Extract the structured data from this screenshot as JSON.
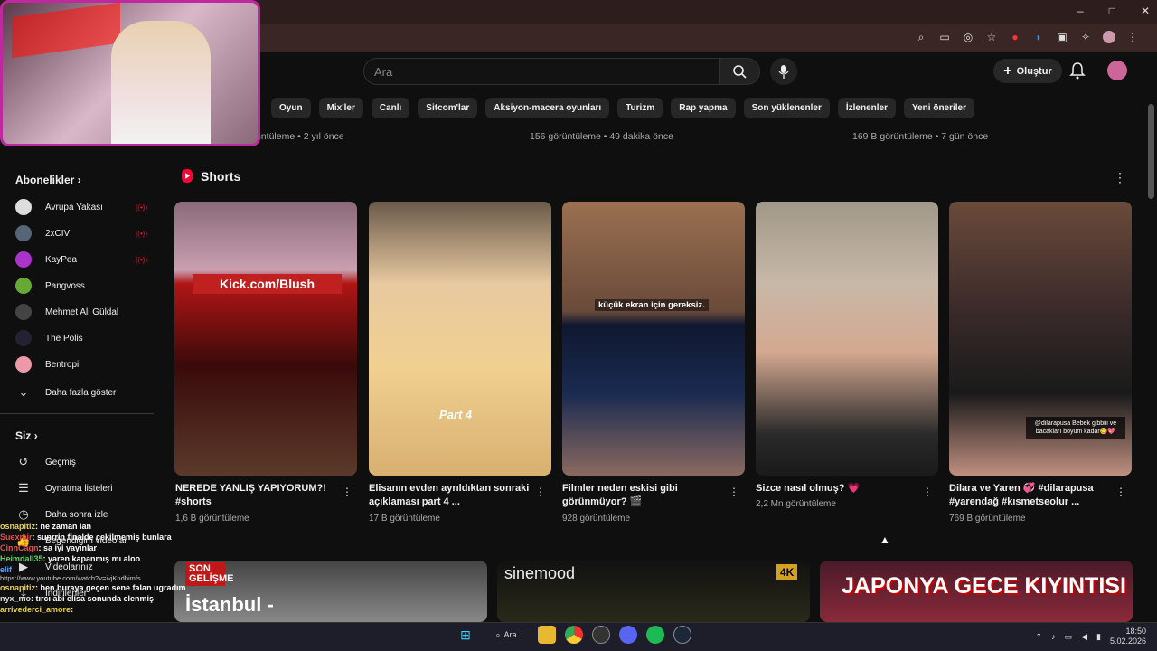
{
  "window": {
    "min": "–",
    "max": "□",
    "close": "✕"
  },
  "search": {
    "placeholder": "Ara"
  },
  "header": {
    "create_label": "Oluştur"
  },
  "chips": [
    "Oyun",
    "Mix'ler",
    "Canlı",
    "Sitcom'lar",
    "Aksiyon-macera oyunları",
    "Turizm",
    "Rap yapma",
    "Son yüklenenler",
    "İzlenenler",
    "Yeni öneriler"
  ],
  "prev_row": {
    "v1": "üntüleme • 2 yıl önce",
    "v2": "156 görüntüleme • 49 dakika önce",
    "v3": "169 B görüntüleme • 7 gün önce"
  },
  "sidebar": {
    "subscriptions_title": "Abonelikler",
    "subs": [
      {
        "label": "Avrupa Yakası",
        "color": "#ddd",
        "live": true
      },
      {
        "label": "2xCIV",
        "color": "#567",
        "live": true
      },
      {
        "label": "KayPea",
        "color": "#a3c",
        "live": true
      },
      {
        "label": "Pangvoss",
        "color": "#6a3",
        "live": false
      },
      {
        "label": "Mehmet Ali Güldal",
        "color": "#444",
        "live": false
      },
      {
        "label": "The Polis",
        "color": "#223",
        "live": false
      },
      {
        "label": "Bentropi",
        "color": "#e9a",
        "live": false
      }
    ],
    "show_more": "Daha fazla göster",
    "you_title": "Siz",
    "you_items": [
      "Geçmiş",
      "Oynatma listeleri",
      "Daha sonra izle",
      "Beğendiğim videolar",
      "Videolarınız",
      "İndirilenler"
    ]
  },
  "shorts": {
    "title": "Shorts",
    "items": [
      {
        "title": "NEREDE YANLIŞ YAPIYORUM?! #shorts",
        "views": "1,6 B görüntüleme",
        "overlay": "Kick.com/Blush"
      },
      {
        "title": "Elisanın evden ayrıldıktan sonraki açıklaması part 4 ...",
        "views": "17 B görüntüleme",
        "overlay": "Part 4"
      },
      {
        "title": "Filmler neden eskisi gibi görünmüyor? 🎬",
        "views": "928 görüntüleme",
        "overlay": "küçük ekran için gereksiz."
      },
      {
        "title": "Sizce nasıl olmuş? 💗",
        "views": "2,2 Mn görüntüleme",
        "overlay": ""
      },
      {
        "title": "Dilara ve Yaren 💞 #dilarapusa #yarendağ #kısmetseolur ...",
        "views": "769 B görüntüleme",
        "overlay": "@dilarapusa Bebek gibbiii ve bacakları boyum kadar😋💖"
      }
    ]
  },
  "big_videos": {
    "v1_badge": "SON GELİŞME",
    "v1_text": "İstanbul -",
    "v2_brand": "sinemood",
    "v2_badge": "4K",
    "v3_text": "JAPONYA GECE KIYINTISI"
  },
  "chat": [
    {
      "user": "osnapitiz",
      "msg": ": ne zaman lan",
      "color": "#e7d24b"
    },
    {
      "user": "Suexmir",
      "msg": ": sunrrin finalde çekilmemiş bunlara",
      "color": "#e05050"
    },
    {
      "user": "CinnCagn",
      "msg": ": sa iyi yayınlar",
      "color": "#e05050"
    },
    {
      "user": "Heimdall35",
      "msg": ": yaren kapanmış mı aloo",
      "color": "#5fd35f"
    },
    {
      "user": "elif",
      "msg": "",
      "color": "#5aa0ff"
    },
    {
      "user": "osnapitiz",
      "msg": ": ben buraya geçen sene falan ugradım",
      "color": "#e7d24b"
    },
    {
      "user": "nyx_mo",
      "msg": ": tırcı abi elisa sonunda elenmiş",
      "color": "#ddd"
    },
    {
      "user": "arrivederci_amore",
      "msg": ":",
      "color": "#e7d24b"
    }
  ],
  "chat_url": "https://www.youtube.com/watch?v=ivjKndbimfs",
  "taskbar": {
    "search": "Ara",
    "time": "18:50",
    "date": "5.02.2026"
  },
  "colors": {
    "bg": "#0f0f0f",
    "accent": "#ff0033"
  }
}
